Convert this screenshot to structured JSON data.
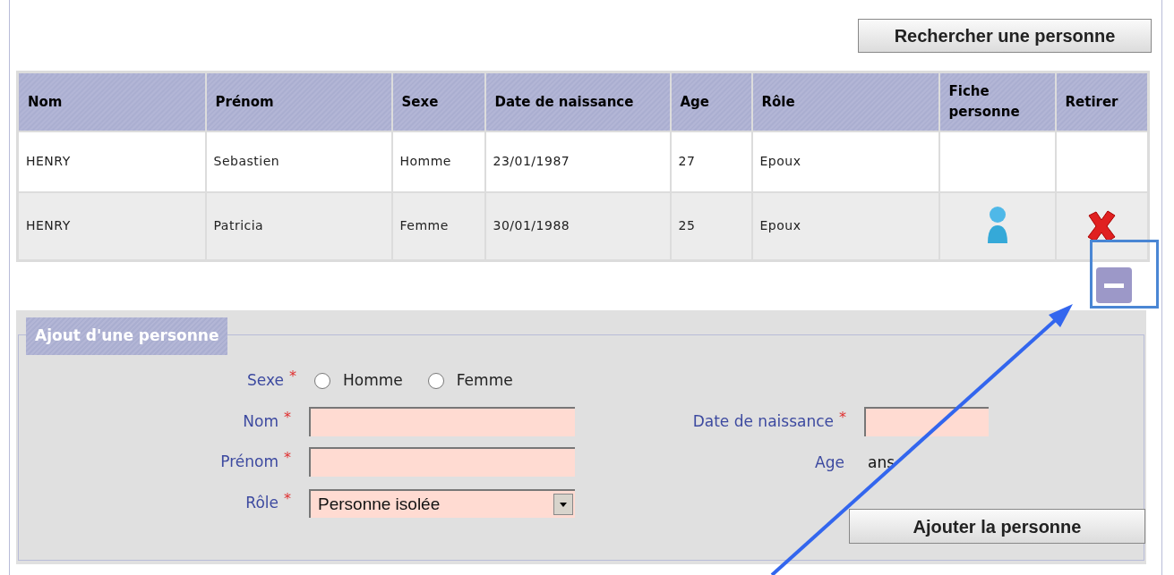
{
  "search_button": "Rechercher une personne",
  "table": {
    "columns": [
      "Nom",
      "Prénom",
      "Sexe",
      "Date de naissance",
      "Age",
      "Rôle",
      "Fiche personne",
      "Retirer"
    ],
    "rows": [
      {
        "cells": [
          "HENRY",
          "Sebastien",
          "Homme",
          "23/01/1987",
          "27",
          "Epoux"
        ],
        "actions": false
      },
      {
        "cells": [
          "HENRY",
          "Patricia",
          "Femme",
          "30/01/1988",
          "25",
          "Epoux"
        ],
        "actions": true
      }
    ]
  },
  "collapse_button": {
    "highlighted": true
  },
  "form": {
    "legend": "Ajout d'une personne",
    "sexe": {
      "label": "Sexe",
      "required": "*",
      "options": [
        {
          "label": "Homme",
          "selected": false
        },
        {
          "label": "Femme",
          "selected": false
        }
      ]
    },
    "nom": {
      "label": "Nom",
      "required": "*"
    },
    "prenom": {
      "label": "Prénom",
      "required": "*"
    },
    "role": {
      "label": "Rôle",
      "required": "*",
      "value": "Personne isolée"
    },
    "date_naissance": {
      "label": "Date de naissance",
      "required": "*"
    },
    "age": {
      "label": "Age",
      "value": "ans"
    },
    "submit": "Ajouter la personne"
  }
}
